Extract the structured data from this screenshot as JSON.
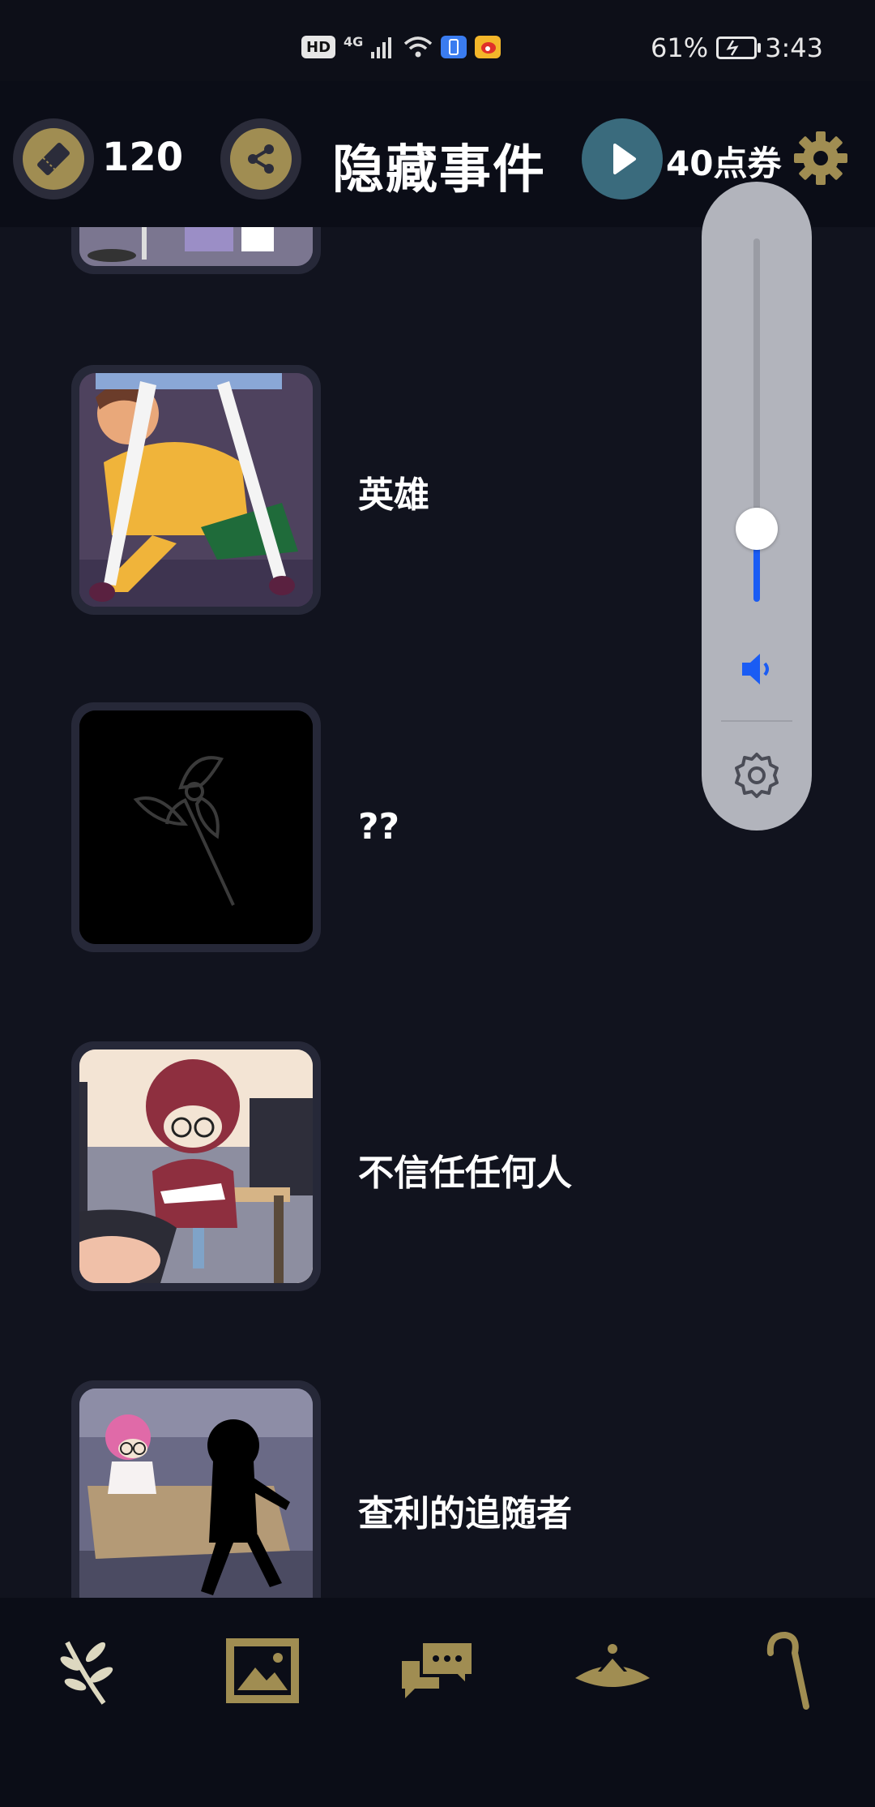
{
  "status_bar": {
    "hd": "HD",
    "network": "4G",
    "battery": "61%",
    "time": "3:43"
  },
  "header": {
    "ticket_count": "120",
    "title": "隐藏事件",
    "points_label": "40点券"
  },
  "events": [
    {
      "label": "英雄",
      "thumb_icon": "hero-scene-image"
    },
    {
      "label": "??",
      "thumb_icon": "locked-flower-image"
    },
    {
      "label": "不信任任何人",
      "thumb_icon": "classroom-scene-image"
    },
    {
      "label": "查利的追随者",
      "thumb_icon": "follower-scene-image"
    }
  ],
  "volume_panel": {
    "level": 0.2,
    "accent": "#1a5cf4"
  },
  "bottom_nav": [
    "branch-icon",
    "gallery-icon",
    "chat-icon",
    "hat-icon",
    "cane-icon"
  ],
  "colors": {
    "gold": "#a08d52",
    "background": "#11131e",
    "bar": "#0b0d17"
  }
}
